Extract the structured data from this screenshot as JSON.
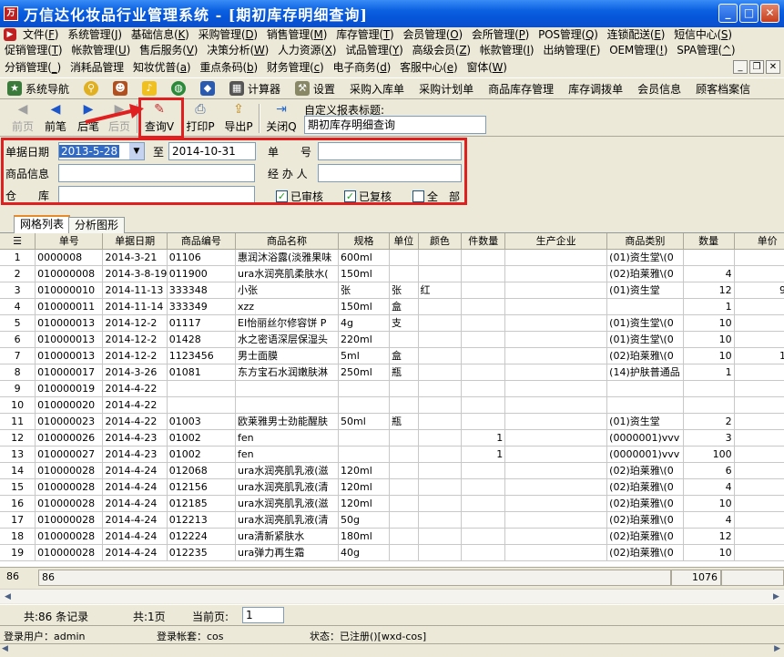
{
  "window": {
    "title": "万信达化妆品行业管理系统 - [期初库存明细查询]"
  },
  "menu1": [
    {
      "label": "文件",
      "key": "F"
    },
    {
      "label": "系统管理",
      "key": "J"
    },
    {
      "label": "基础信息",
      "key": "K"
    },
    {
      "label": "采购管理",
      "key": "D"
    },
    {
      "label": "销售管理",
      "key": "M"
    },
    {
      "label": "库存管理",
      "key": "T"
    },
    {
      "label": "会员管理",
      "key": "O"
    },
    {
      "label": "会所管理",
      "key": "P"
    },
    {
      "label": "POS管理",
      "key": "Q"
    },
    {
      "label": "连锁配送",
      "key": "E"
    },
    {
      "label": "短信中心",
      "key": "S"
    }
  ],
  "menu2": [
    {
      "label": "促销管理",
      "key": "T"
    },
    {
      "label": "帐款管理",
      "key": "U"
    },
    {
      "label": "售后服务",
      "key": "V"
    },
    {
      "label": "决策分析",
      "key": "W"
    },
    {
      "label": "人力资源",
      "key": "X"
    },
    {
      "label": "试品管理",
      "key": "Y"
    },
    {
      "label": "高级会员",
      "key": "Z"
    },
    {
      "label": "帐款管理",
      "key": "I"
    },
    {
      "label": "出纳管理",
      "key": "F"
    },
    {
      "label": "OEM管理",
      "key": "!"
    },
    {
      "label": "SPA管理",
      "key": "^"
    }
  ],
  "menu3": [
    {
      "label": "分销管理",
      "key": "_"
    },
    {
      "label": "消耗品管理",
      "key": ""
    },
    {
      "label": "知妆优普",
      "key": "a"
    },
    {
      "label": "重点条码",
      "key": "b"
    },
    {
      "label": "财务管理",
      "key": "c"
    },
    {
      "label": "电子商务",
      "key": "d"
    },
    {
      "label": "客服中心",
      "key": "e"
    },
    {
      "label": "窗体",
      "key": "W"
    }
  ],
  "navbar": [
    "系统导航",
    "",
    "",
    "",
    "",
    "",
    "计算器",
    "设置",
    "采购入库单",
    "采购计划单",
    "商品库存管理",
    "库存调拨单",
    "会员信息",
    "顾客档案信"
  ],
  "toolbar": {
    "prev": "前页",
    "first": "前笔",
    "next": "后笔",
    "last": "后页",
    "query": "查询V",
    "print": "打印P",
    "export": "导出P",
    "close": "关闭Q",
    "report_title_label": "自定义报表标题:",
    "report_title_value": "期初库存明细查询"
  },
  "filter": {
    "date_label": "单据日期",
    "date_from": "2013-5-28",
    "to_label": "至",
    "date_to": "2014-10-31",
    "no_label": "单　　号",
    "goods_label": "商品信息",
    "handler_label": "经 办 人",
    "warehouse_label": "仓　　库",
    "cb1": "已审核",
    "cb2": "已复核",
    "cb3": "全　部"
  },
  "tabs": [
    "网格列表",
    "分析图形"
  ],
  "columns": [
    "",
    "单号",
    "单据日期",
    "商品编号",
    "商品名称",
    "规格",
    "单位",
    "颜色",
    "件数量",
    "生产企业",
    "商品类别",
    "数量",
    "单价"
  ],
  "rows": [
    [
      "1",
      "0000008",
      "2014-3-21",
      "01106",
      "惠润沐浴露(淡雅果味",
      "600ml",
      "",
      "",
      "",
      "",
      "(01)资生堂\\(0",
      "",
      ""
    ],
    [
      "2",
      "010000008",
      "2014-3-8-19",
      "011900",
      "ura水润亮肌柔肤水(",
      "150ml",
      "",
      "",
      "",
      "",
      "(02)珀莱雅\\(0",
      "4",
      "5"
    ],
    [
      "3",
      "010000010",
      "2014-11-13",
      "333348",
      "小张",
      "张",
      "张",
      "红",
      "",
      "",
      "(01)资生堂",
      "12",
      "998"
    ],
    [
      "4",
      "010000011",
      "2014-11-14",
      "333349",
      "xzz",
      "150ml",
      "盒",
      "",
      "",
      "",
      "",
      "1",
      "10"
    ],
    [
      "5",
      "010000013",
      "2014-12-2",
      "01117",
      "EI怡丽丝尔修容饼 P",
      "4g",
      "支",
      "",
      "",
      "",
      "(01)资生堂\\(0",
      "10",
      "80"
    ],
    [
      "6",
      "010000013",
      "2014-12-2",
      "01428",
      "水之密语深层保湿头",
      "220ml",
      "",
      "",
      "",
      "",
      "(01)资生堂\\(0",
      "10",
      "90"
    ],
    [
      "7",
      "010000013",
      "2014-12-2",
      "1123456",
      "男士面膜",
      "5ml",
      "盒",
      "",
      "",
      "",
      "(02)珀莱雅\\(0",
      "10",
      "100"
    ],
    [
      "8",
      "010000017",
      "2014-3-26",
      "01081",
      "东方宝石水润嫩肤淋",
      "250ml",
      "瓶",
      "",
      "",
      "",
      "(14)护肤普通品",
      "1",
      ""
    ],
    [
      "9",
      "010000019",
      "2014-4-22",
      "",
      "",
      "",
      "",
      "",
      "",
      "",
      "",
      "",
      ""
    ],
    [
      "10",
      "010000020",
      "2014-4-22",
      "",
      "",
      "",
      "",
      "",
      "",
      "",
      "",
      "",
      ""
    ],
    [
      "11",
      "010000023",
      "2014-4-22",
      "01003",
      "欧莱雅男士劲能醒肤",
      "50ml",
      "瓶",
      "",
      "",
      "",
      "(01)资生堂",
      "2",
      "12"
    ],
    [
      "12",
      "010000026",
      "2014-4-23",
      "01002",
      "fen",
      "",
      "",
      "",
      "1",
      "",
      "(0000001)vvv",
      "3",
      "12"
    ],
    [
      "13",
      "010000027",
      "2014-4-23",
      "01002",
      "fen",
      "",
      "",
      "",
      "1",
      "",
      "(0000001)vvv",
      "100",
      "12"
    ],
    [
      "14",
      "010000028",
      "2014-4-24",
      "012068",
      "ura水润亮肌乳液(滋",
      "120ml",
      "",
      "",
      "",
      "",
      "(02)珀莱雅\\(0",
      "6",
      "2"
    ],
    [
      "15",
      "010000028",
      "2014-4-24",
      "012156",
      "ura水润亮肌乳液(清",
      "120ml",
      "",
      "",
      "",
      "",
      "(02)珀莱雅\\(0",
      "4",
      "5"
    ],
    [
      "16",
      "010000028",
      "2014-4-24",
      "012185",
      "ura水润亮肌乳液(滋",
      "120ml",
      "",
      "",
      "",
      "",
      "(02)珀莱雅\\(0",
      "10",
      "8"
    ],
    [
      "17",
      "010000028",
      "2014-4-24",
      "012213",
      "ura水润亮肌乳液(清",
      "50g",
      "",
      "",
      "",
      "",
      "(02)珀莱雅\\(0",
      "4",
      "11"
    ],
    [
      "18",
      "010000028",
      "2014-4-24",
      "012224",
      "ura清新紧肤水",
      "180ml",
      "",
      "",
      "",
      "",
      "(02)珀莱雅\\(0",
      "12",
      "14"
    ],
    [
      "19",
      "010000028",
      "2014-4-24",
      "012235",
      "ura弹力再生霜",
      "40g",
      "",
      "",
      "",
      "",
      "(02)珀莱雅\\(0",
      "10",
      "17"
    ]
  ],
  "footer": {
    "count_left": "86",
    "count_no": "86",
    "sum_qty": "1076"
  },
  "status": {
    "records": "共:86 条记录",
    "pages": "共:1页",
    "current_label": "当前页:",
    "current_value": "1",
    "user": "登录用户：admin",
    "account": "登录帐套：cos",
    "state": "状态：已注册()[wxd-cos]"
  }
}
